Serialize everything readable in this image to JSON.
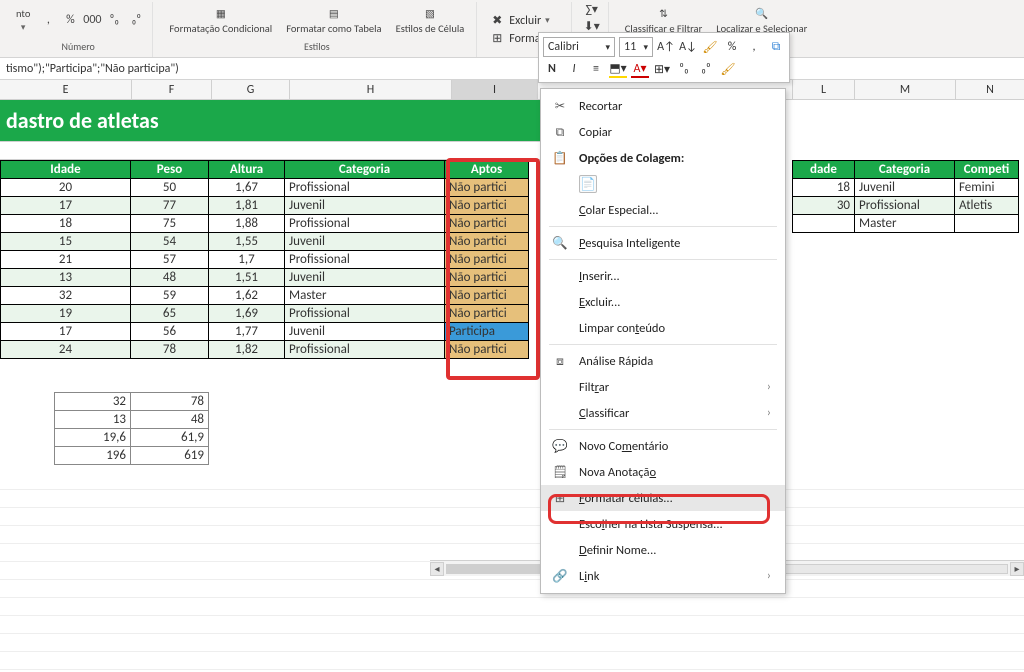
{
  "ribbon": {
    "nto_label": "nto",
    "numero_label": "Número",
    "cond_label": "Formatação Condicional",
    "table_label": "Formatar como Tabela",
    "styles_label": "Estilos de Célula",
    "estilos_group": "Estilos",
    "excluir_label": "Excluir",
    "formatar_label": "Formatar",
    "sort_label": "Classificar e Filtrar",
    "find_label": "Localizar e Selecionar",
    "percent": "%",
    "thousands": "000"
  },
  "formula": "tismo\");\"Participa\";\"Não participa\")",
  "mini": {
    "font": "Calibri",
    "size": "11",
    "bold": "N",
    "italic": "I"
  },
  "ctx": {
    "recortar": "Recortar",
    "copiar": "Copiar",
    "opcoes": "Opções de Colagem:",
    "colar_esp": "Colar Especial...",
    "pesquisa": "Pesquisa Inteligente",
    "inserir": "Inserir...",
    "excluir": "Excluir...",
    "limpar": "Limpar conteúdo",
    "analise": "Análise Rápida",
    "filtrar": "Filtrar",
    "classificar": "Classificar",
    "novo_com": "Novo Comentário",
    "nova_anot": "Nova Anotação",
    "formatar": "Formatar células...",
    "escolher": "Escolher na Lista Suspensa...",
    "definir": "Definir Nome..."
  },
  "title": "dastro de atletas",
  "cols": {
    "E": "E",
    "F": "F",
    "G": "G",
    "H": "H",
    "I": "I",
    "L": "L",
    "M": "M",
    "N": "N"
  },
  "headers": {
    "idade": "Idade",
    "peso": "Peso",
    "altura": "Altura",
    "categoria": "Categoria",
    "aptos": "Aptos",
    "dade": "dade",
    "categoria2": "Categoria",
    "compe": "Competi"
  },
  "rows": [
    {
      "idade": "20",
      "peso": "50",
      "altura": "1,67",
      "cat": "Profissional",
      "aptos": "Não partici"
    },
    {
      "idade": "17",
      "peso": "77",
      "altura": "1,81",
      "cat": "Juvenil",
      "aptos": "Não partici"
    },
    {
      "idade": "18",
      "peso": "75",
      "altura": "1,88",
      "cat": "Profissional",
      "aptos": "Não partici"
    },
    {
      "idade": "15",
      "peso": "54",
      "altura": "1,55",
      "cat": "Juvenil",
      "aptos": "Não partici"
    },
    {
      "idade": "21",
      "peso": "57",
      "altura": "1,7",
      "cat": "Profissional",
      "aptos": "Não partici"
    },
    {
      "idade": "13",
      "peso": "48",
      "altura": "1,51",
      "cat": "Juvenil",
      "aptos": "Não partici"
    },
    {
      "idade": "32",
      "peso": "59",
      "altura": "1,62",
      "cat": "Master",
      "aptos": "Não partici"
    },
    {
      "idade": "19",
      "peso": "65",
      "altura": "1,69",
      "cat": "Profissional",
      "aptos": "Não partici"
    },
    {
      "idade": "17",
      "peso": "56",
      "altura": "1,77",
      "cat": "Juvenil",
      "aptos": "Participa"
    },
    {
      "idade": "24",
      "peso": "78",
      "altura": "1,82",
      "cat": "Profissional",
      "aptos": "Não partici"
    }
  ],
  "stats": [
    {
      "a": "32",
      "b": "78"
    },
    {
      "a": "13",
      "b": "48"
    },
    {
      "a": "19,6",
      "b": "61,9"
    },
    {
      "a": "196",
      "b": "619"
    }
  ],
  "right_rows": [
    {
      "dade": "18",
      "cat": "Juvenil",
      "comp": "Femini"
    },
    {
      "dade": "30",
      "cat": "Profissional",
      "comp": "Atletis"
    },
    {
      "dade": "",
      "cat": "Master",
      "comp": ""
    }
  ],
  "col_widths": {
    "E": 118,
    "F": 80,
    "G": 78,
    "H": 132,
    "I": 86,
    "gap": 252,
    "L": 62,
    "M": 100,
    "N": 60
  }
}
